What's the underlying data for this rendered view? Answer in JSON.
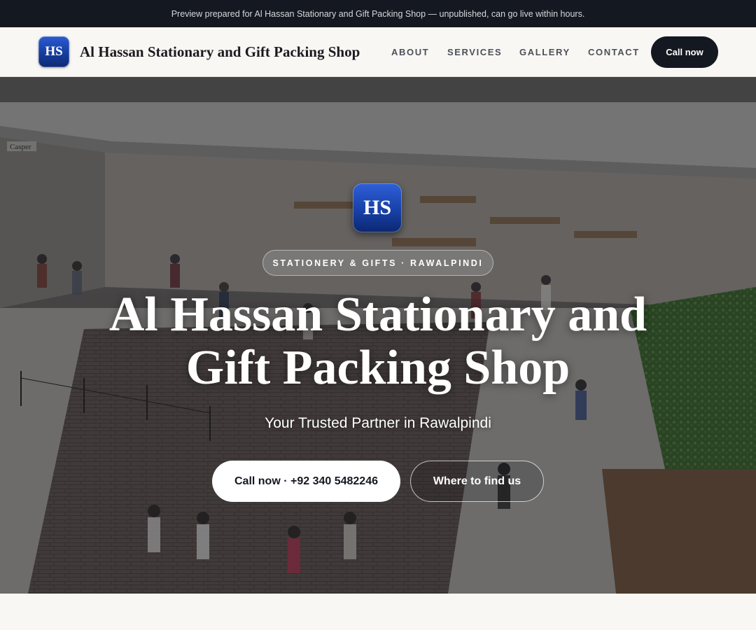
{
  "preview_bar": {
    "text": "Preview prepared for Al Hassan Stationary and Gift Packing Shop — unpublished, can go live within hours."
  },
  "nav": {
    "logo_initials": "HS",
    "brand": "Al Hassan Stationary and Gift Packing Shop",
    "links": [
      "ABOUT",
      "SERVICES",
      "GALLERY",
      "CONTACT"
    ],
    "cta": "Call now"
  },
  "hero": {
    "badge_initials": "HS",
    "eyebrow": "STATIONERY & GIFTS · RAWALPINDI",
    "title_line1": "Al Hassan Stationary and",
    "title_line2": "Gift Packing Shop",
    "subtitle": "Your Trusted Partner in Rawalpindi",
    "primary_button": "Call now · +92 340 5482246",
    "secondary_button": "Where to find us",
    "store_sign": "Casper"
  }
}
